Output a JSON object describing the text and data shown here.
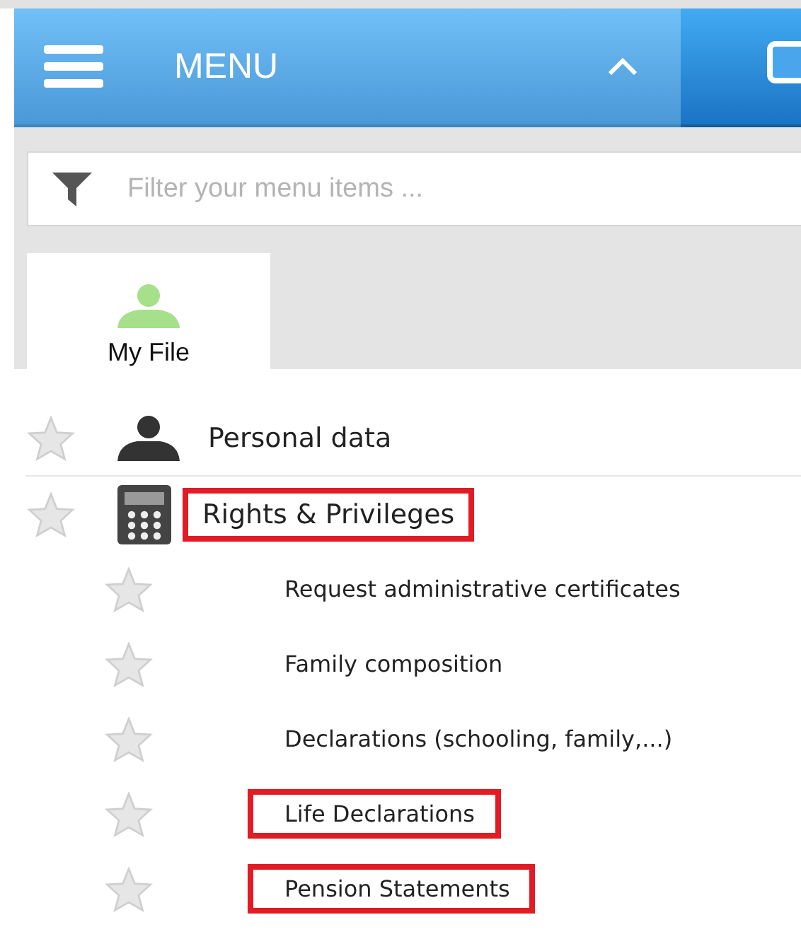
{
  "header": {
    "title": "MENU"
  },
  "filter": {
    "placeholder": "Filter your menu items ..."
  },
  "tabs": [
    {
      "label": "My File",
      "selected": true
    }
  ],
  "menu": [
    {
      "label": "Personal data",
      "kind": "person",
      "highlighted": false
    },
    {
      "label": "Rights & Privileges",
      "kind": "calculator",
      "highlighted": true,
      "children": [
        {
          "label": "Request administrative certificates",
          "highlighted": false
        },
        {
          "label": "Family composition",
          "highlighted": false
        },
        {
          "label": "Declarations (schooling, family,...)",
          "highlighted": false
        },
        {
          "label": "Life Declarations",
          "highlighted": true
        },
        {
          "label": "Pension Statements",
          "highlighted": true
        }
      ]
    }
  ]
}
